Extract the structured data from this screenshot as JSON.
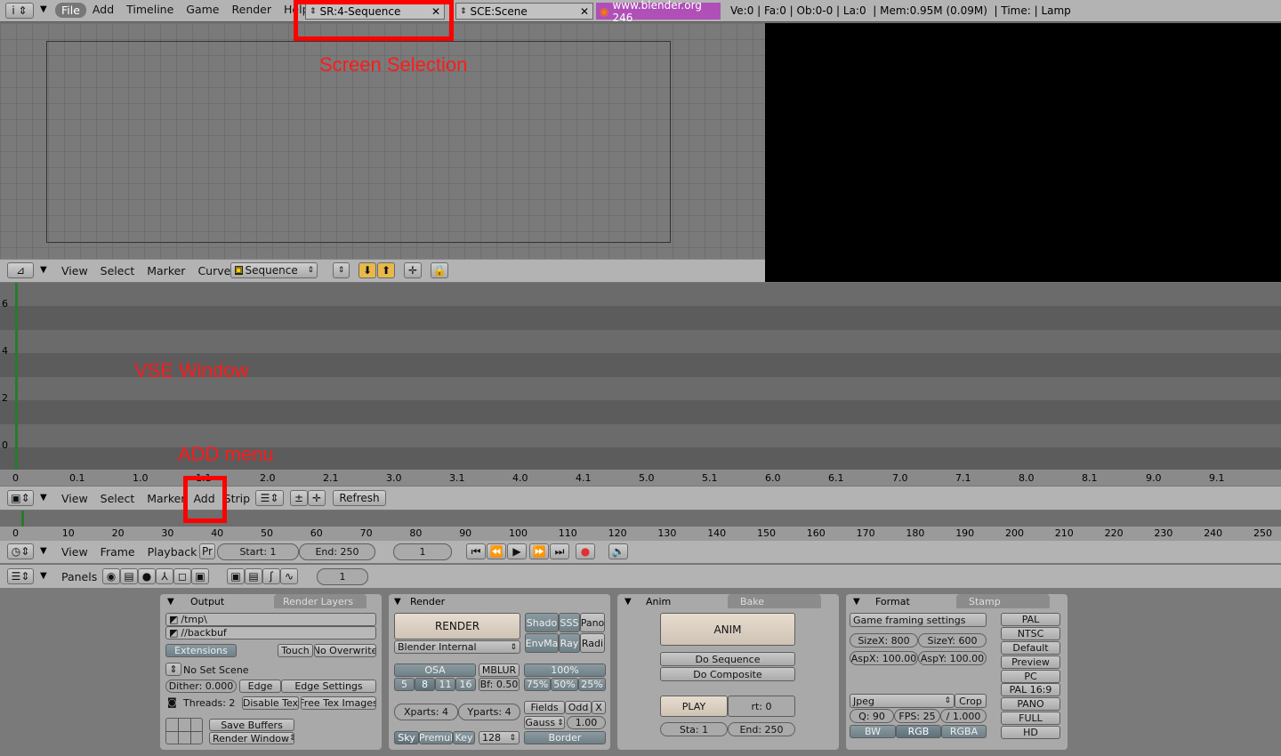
{
  "top_bar": {
    "menu": [
      "File",
      "Add",
      "Timeline",
      "Game",
      "Render",
      "Help"
    ],
    "screen": "SR:4-Sequence",
    "scene": "SCE:Scene",
    "url": "www.blender.org 246",
    "stats": "Ve:0 | Fa:0 | Ob:0-0 | La:0  | Mem:0.95M (0.09M)  | Time: | Lamp"
  },
  "ipo_header": {
    "menu": [
      "View",
      "Select",
      "Marker",
      "Curve"
    ],
    "ipo_type": "Sequence"
  },
  "vse": {
    "y_ticks": [
      "6",
      "4",
      "2",
      "0"
    ],
    "x_ticks": [
      "0",
      "0.1",
      "1.0",
      "1.1",
      "2.0",
      "2.1",
      "3.0",
      "3.1",
      "4.0",
      "4.1",
      "5.0",
      "5.1",
      "6.0",
      "6.1",
      "7.0",
      "7.1",
      "8.0",
      "8.1",
      "9.0",
      "9.1"
    ],
    "menu": [
      "View",
      "Select",
      "Marker",
      "Add",
      "Strip"
    ],
    "refresh": "Refresh"
  },
  "timeline": {
    "ticks": [
      "0",
      "10",
      "20",
      "30",
      "40",
      "50",
      "60",
      "70",
      "80",
      "90",
      "100",
      "110",
      "120",
      "130",
      "140",
      "150",
      "160",
      "170",
      "180",
      "190",
      "200",
      "210",
      "220",
      "230",
      "240",
      "250"
    ],
    "menu": [
      "View",
      "Frame",
      "Playback"
    ],
    "pr": "Pr",
    "start": "Start: 1",
    "end": "End: 250",
    "current": "1"
  },
  "buttons_header": {
    "label": "Panels",
    "frame": "1"
  },
  "output_panel": {
    "tabs": [
      "Output",
      "Render Layers"
    ],
    "path1": "/tmp\\",
    "path2": "//backbuf",
    "extensions": "Extensions",
    "touch": "Touch",
    "no_overwrite": "No Overwrite",
    "no_set_scene": "No Set Scene",
    "dither": "Dither: 0.000",
    "edge": "Edge",
    "edge_settings": "Edge Settings",
    "threads": "Threads: 2",
    "disable_tex": "Disable Tex",
    "free_tex": "Free Tex Images",
    "save_buffers": "Save Buffers",
    "render_window": "Render Window"
  },
  "render_panel": {
    "tab": "Render",
    "render": "RENDER",
    "engine": "Blender Internal",
    "shado": "Shado",
    "sss": "SSS",
    "pano": "Pano",
    "envma": "EnvMa",
    "ray": "Ray",
    "radi": "Radi",
    "osa": "OSA",
    "osa_vals": [
      "5",
      "8",
      "11",
      "16"
    ],
    "mblur": "MBLUR",
    "bf": "Bf: 0.50",
    "pct": "100%",
    "pct_vals": [
      "75%",
      "50%",
      "25%"
    ],
    "xparts": "Xparts: 4",
    "yparts": "Yparts: 4",
    "fields": "Fields",
    "odd": "Odd",
    "x": "X",
    "gauss": "Gauss",
    "gauss_val": "1.00",
    "sky": "Sky",
    "premul": "Premul",
    "key": "Key",
    "bits": "128",
    "border": "Border"
  },
  "anim_panel": {
    "tabs": [
      "Anim",
      "Bake"
    ],
    "anim": "ANIM",
    "do_sequence": "Do Sequence",
    "do_composite": "Do Composite",
    "play": "PLAY",
    "rt": "rt: 0",
    "sta": "Sta: 1",
    "end": "End: 250"
  },
  "format_panel": {
    "tabs": [
      "Format",
      "Stamp"
    ],
    "game_framing": "Game framing settings",
    "sizex": "SizeX: 800",
    "sizey": "SizeY: 600",
    "aspx": "AspX: 100.00",
    "aspy": "AspY: 100.00",
    "format": "Jpeg",
    "crop": "Crop",
    "q": "Q: 90",
    "fps": "FPS: 25",
    "fps_div": "/ 1.000",
    "bw": "BW",
    "rgb": "RGB",
    "rgba": "RGBA",
    "presets": [
      "PAL",
      "NTSC",
      "Default",
      "Preview",
      "PC",
      "PAL 16:9",
      "PANO",
      "FULL",
      "HD"
    ]
  },
  "annotations": {
    "screen_selection": "Screen Selection",
    "vse_window": "VSE Window",
    "add_menu": "ADD menu"
  },
  "colors": {
    "annotation": "#ff0000",
    "url_bg": "#b04fb8",
    "header": "#b3b3b3"
  }
}
